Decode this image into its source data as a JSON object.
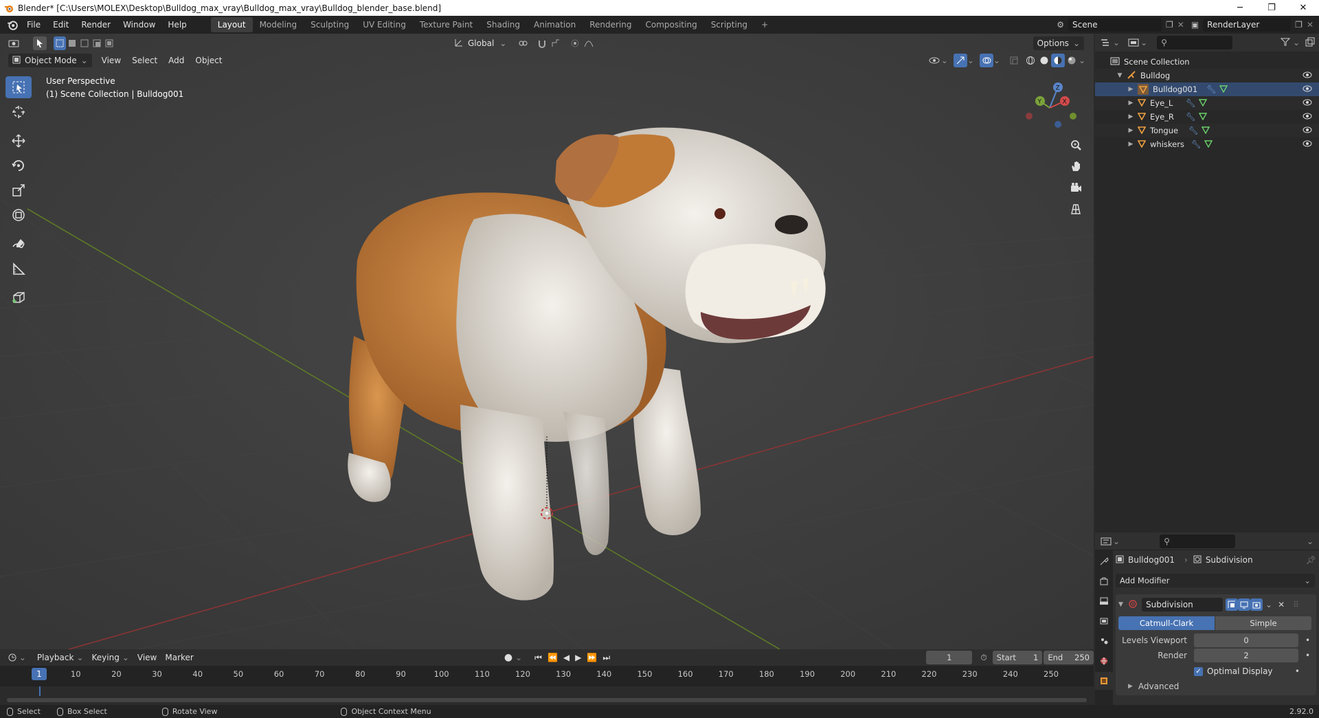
{
  "window": {
    "title": "Blender* [C:\\Users\\MOLEX\\Desktop\\Bulldog_max_vray\\Bulldog_max_vray\\Bulldog_blender_base.blend]",
    "minimize": "─",
    "restore": "❐",
    "close": "✕"
  },
  "menubar": {
    "menus": [
      "File",
      "Edit",
      "Render",
      "Window",
      "Help"
    ],
    "workspaces": [
      "Layout",
      "Modeling",
      "Sculpting",
      "UV Editing",
      "Texture Paint",
      "Shading",
      "Animation",
      "Rendering",
      "Compositing",
      "Scripting"
    ],
    "active_workspace": "Layout",
    "add_workspace": "+",
    "scene": "Scene",
    "render_layer": "RenderLayer"
  },
  "viewport": {
    "orientation": "Global",
    "options": "Options",
    "mode": "Object Mode",
    "menus": [
      "View",
      "Select",
      "Add",
      "Object"
    ],
    "info_line1": "User Perspective",
    "info_line2": "(1) Scene Collection | Bulldog001",
    "gizmo": {
      "x": "X",
      "y": "Y",
      "z": "Z"
    }
  },
  "outliner": {
    "root": "Scene Collection",
    "collection": "Bulldog",
    "objects": [
      "Bulldog001",
      "Eye_L",
      "Eye_R",
      "Tongue",
      "whiskers"
    ]
  },
  "properties": {
    "object_name": "Bulldog001",
    "modifier_crumb": "Subdivision",
    "add_modifier": "Add Modifier",
    "modifier_name": "Subdivision",
    "mode_catmull": "Catmull-Clark",
    "mode_simple": "Simple",
    "levels_viewport_label": "Levels Viewport",
    "levels_viewport_value": "0",
    "render_label": "Render",
    "render_value": "2",
    "optimal_display": "Optimal Display",
    "advanced": "Advanced"
  },
  "timeline": {
    "menus": [
      "Playback",
      "Keying",
      "View",
      "Marker"
    ],
    "current_frame": "1",
    "start_label": "Start",
    "start_value": "1",
    "end_label": "End",
    "end_value": "250",
    "ticks": [
      "10",
      "20",
      "30",
      "40",
      "50",
      "60",
      "70",
      "80",
      "90",
      "100",
      "110",
      "120",
      "130",
      "140",
      "150",
      "160",
      "170",
      "180",
      "190",
      "200",
      "210",
      "220",
      "230",
      "240",
      "250"
    ],
    "playhead": "1"
  },
  "statusbar": {
    "select": "Select",
    "box_select": "Box Select",
    "rotate_view": "Rotate View",
    "context_menu": "Object Context Menu",
    "version": "2.92.0"
  },
  "colors": {
    "accent": "#4772b3",
    "x_axis": "#b33a3a",
    "y_axis": "#6b8e23",
    "object_orange": "#e89a3c"
  }
}
